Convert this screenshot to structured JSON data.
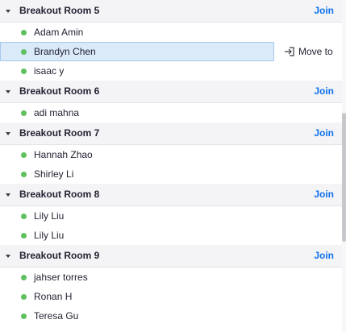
{
  "rooms": [
    {
      "name": "Breakout Room 5",
      "join_label": "Join",
      "members": [
        {
          "name": "Adam Amin"
        },
        {
          "name": "Brandyn Chen",
          "selected": true,
          "action_label": "Move to"
        },
        {
          "name": "isaac y"
        }
      ]
    },
    {
      "name": "Breakout Room 6",
      "join_label": "Join",
      "members": [
        {
          "name": "adi mahna"
        }
      ]
    },
    {
      "name": "Breakout Room 7",
      "join_label": "Join",
      "members": [
        {
          "name": "Hannah Zhao"
        },
        {
          "name": "Shirley Li"
        }
      ]
    },
    {
      "name": "Breakout Room 8",
      "join_label": "Join",
      "members": [
        {
          "name": "Lily Liu"
        },
        {
          "name": "Lily Liu"
        }
      ]
    },
    {
      "name": "Breakout Room 9",
      "join_label": "Join",
      "members": [
        {
          "name": "jahser torres"
        },
        {
          "name": "Ronan H"
        },
        {
          "name": "Teresa Gu"
        }
      ]
    }
  ],
  "colors": {
    "online_dot": "#5ec15e",
    "join_link": "#0e71eb",
    "selected_row": "#daeaf9",
    "header_bg": "#f4f4f6"
  }
}
